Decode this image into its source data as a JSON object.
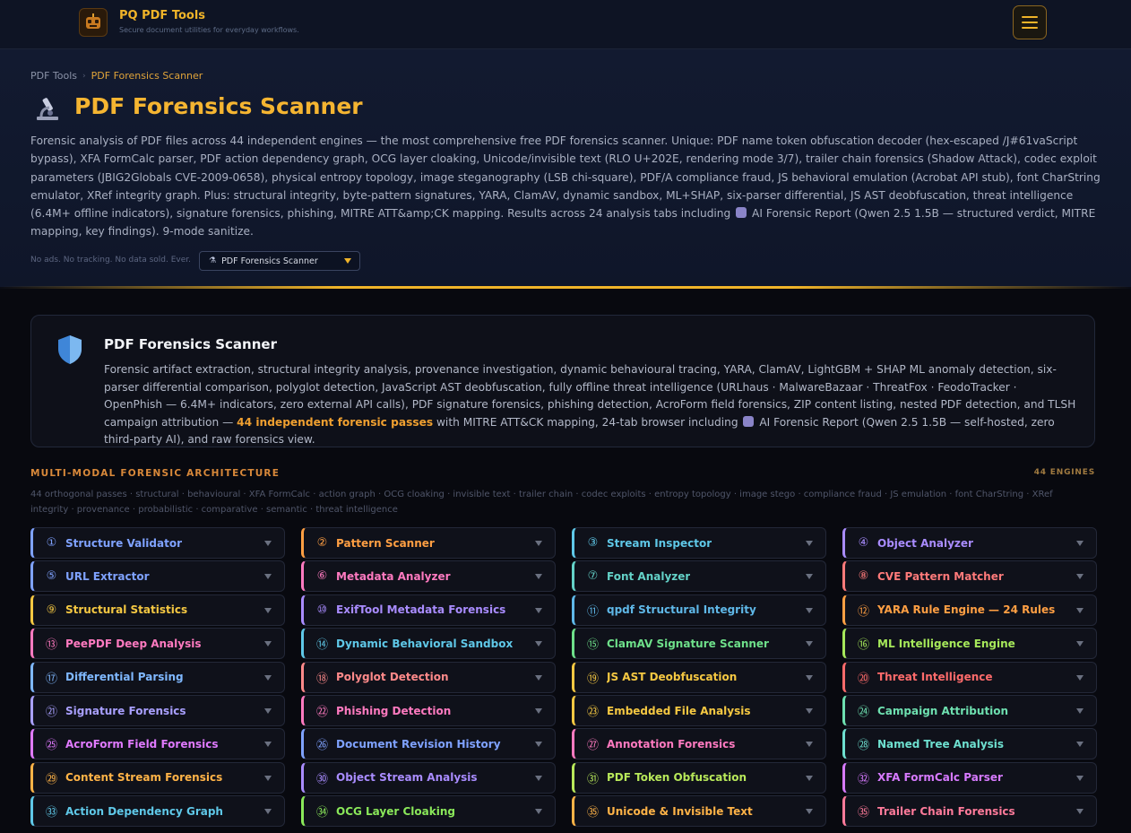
{
  "header": {
    "brand_title": "PQ PDF Tools",
    "brand_subtitle": "Secure document utilities for everyday workflows.",
    "logo_icon": "robot-logo-icon",
    "menu_icon": "hamburger-menu-icon"
  },
  "breadcrumb": {
    "root": "PDF Tools",
    "current": "PDF Forensics Scanner"
  },
  "hero": {
    "title": "PDF Forensics Scanner",
    "title_icon": "microscope-icon",
    "description_before_ai": "Forensic analysis of PDF files across 44 independent engines — the most comprehensive free PDF forensics scanner. Unique: PDF name token obfuscation decoder (hex-escaped /J#61vaScript bypass), XFA FormCalc parser, PDF action dependency graph, OCG layer cloaking, Unicode/invisible text (RLO U+202E, rendering mode 3/7), trailer chain forensics (Shadow Attack), codec exploit parameters (JBIG2Globals CVE-2009-0658), physical entropy topology, image steganography (LSB chi-square), PDF/A compliance fraud, JS behavioral emulation (Acrobat API stub), font CharString emulator, XRef integrity graph. Plus: structural integrity, byte-pattern signatures, YARA, ClamAV, dynamic sandbox, ML+SHAP, six-parser differential, JS AST deobfuscation, threat intelligence (6.4M+ offline indicators), signature forensics, phishing, MITRE ATT&amp;CK mapping. Results across 24 analysis tabs including",
    "description_after_ai": "AI Forensic Report (Qwen 2.5 1.5B — structured verdict, MITRE mapping, key findings). 9-mode sanitize.",
    "tagline": "No ads. No tracking. No data sold. Ever.",
    "tool_select_value": "PDF Forensics Scanner"
  },
  "card": {
    "title": "PDF Forensics Scanner",
    "body_part1": "Forensic artifact extraction, structural integrity analysis, provenance investigation, dynamic behavioural tracing, YARA, ClamAV, LightGBM + SHAP ML anomaly detection, six-parser differential comparison, polyglot detection, JavaScript AST deobfuscation, fully offline threat intelligence (URLhaus · MalwareBazaar · ThreatFox · FeodoTracker · OpenPhish — 6.4M+ indicators, zero external API calls), PDF signature forensics, phishing detection, AcroForm field forensics, ZIP content listing, nested PDF detection, and TLSH campaign attribution —",
    "body_highlight": "44 independent forensic passes",
    "body_part2": "with MITRE ATT&CK mapping, 24-tab browser including",
    "body_part3": "AI Forensic Report (Qwen 2.5 1.5B — self-hosted, zero third-party AI), and raw forensics view.",
    "icon": "shield-icon"
  },
  "architecture": {
    "title": "MULTI-MODAL FORENSIC ARCHITECTURE",
    "count": "44 ENGINES",
    "description": "44 orthogonal passes · structural · behavioural · XFA FormCalc · action graph · OCG cloaking · invisible text · trailer chain · codec exploits · entropy topology · image stego · compliance fraud · JS emulation · font CharString · XRef integrity · provenance · probabilistic · comparative · semantic · threat intelligence"
  },
  "engines": [
    {
      "n": "①",
      "label": "Structure Validator",
      "color": "#7fa2ff"
    },
    {
      "n": "②",
      "label": "Pattern Scanner",
      "color": "#ff9f43"
    },
    {
      "n": "③",
      "label": "Stream Inspector",
      "color": "#5fc8e8"
    },
    {
      "n": "④",
      "label": "Object Analyzer",
      "color": "#a98cff"
    },
    {
      "n": "⑤",
      "label": "URL Extractor",
      "color": "#7fa2ff"
    },
    {
      "n": "⑥",
      "label": "Metadata Analyzer",
      "color": "#ff7ac0"
    },
    {
      "n": "⑦",
      "label": "Font Analyzer",
      "color": "#64d2c8"
    },
    {
      "n": "⑧",
      "label": "CVE Pattern Matcher",
      "color": "#ff7a7a"
    },
    {
      "n": "⑨",
      "label": "Structural Statistics",
      "color": "#f5c842"
    },
    {
      "n": "⑩",
      "label": "ExifTool Metadata Forensics",
      "color": "#a98cff"
    },
    {
      "n": "⑪",
      "label": "qpdf Structural Integrity",
      "color": "#5fb8e8"
    },
    {
      "n": "⑫",
      "label": "YARA Rule Engine — 24 Rules",
      "color": "#ff9f43"
    },
    {
      "n": "⑬",
      "label": "PeePDF Deep Analysis",
      "color": "#ff7ac0"
    },
    {
      "n": "⑭",
      "label": "Dynamic Behavioral Sandbox",
      "color": "#5fc8e8"
    },
    {
      "n": "⑮",
      "label": "ClamAV Signature Scanner",
      "color": "#6ee08a"
    },
    {
      "n": "⑯",
      "label": "ML Intelligence Engine",
      "color": "#a6e85a"
    },
    {
      "n": "⑰",
      "label": "Differential Parsing",
      "color": "#7fb8ff"
    },
    {
      "n": "⑱",
      "label": "Polyglot Detection",
      "color": "#ff8a8a"
    },
    {
      "n": "⑲",
      "label": "JS AST Deobfuscation",
      "color": "#f5c842"
    },
    {
      "n": "⑳",
      "label": "Threat Intelligence",
      "color": "#ff6b6b"
    },
    {
      "n": "㉑",
      "label": "Signature Forensics",
      "color": "#a9a0ff"
    },
    {
      "n": "㉒",
      "label": "Phishing Detection",
      "color": "#ff7ac0"
    },
    {
      "n": "㉓",
      "label": "Embedded File Analysis",
      "color": "#f5c842"
    },
    {
      "n": "㉔",
      "label": "Campaign Attribution",
      "color": "#6ee0b0"
    },
    {
      "n": "㉕",
      "label": "AcroForm Field Forensics",
      "color": "#e07aff"
    },
    {
      "n": "㉖",
      "label": "Document Revision History",
      "color": "#7fa2ff"
    },
    {
      "n": "㉗",
      "label": "Annotation Forensics",
      "color": "#ff7ac0"
    },
    {
      "n": "㉘",
      "label": "Named Tree Analysis",
      "color": "#6ee0d0"
    },
    {
      "n": "㉙",
      "label": "Content Stream Forensics",
      "color": "#ffb347"
    },
    {
      "n": "㉚",
      "label": "Object Stream Analysis",
      "color": "#a98cff"
    },
    {
      "n": "㉛",
      "label": "PDF Token Obfuscation",
      "color": "#b8e85a"
    },
    {
      "n": "㉜",
      "label": "XFA FormCalc Parser",
      "color": "#d77aff"
    },
    {
      "n": "㉝",
      "label": "Action Dependency Graph",
      "color": "#5fc8e8"
    },
    {
      "n": "㉞",
      "label": "OCG Layer Cloaking",
      "color": "#8ae85a"
    },
    {
      "n": "㉟",
      "label": "Unicode & Invisible Text",
      "color": "#ffb347"
    },
    {
      "n": "㉟",
      "label": "Trailer Chain Forensics",
      "color": "#ff7a9a"
    }
  ]
}
